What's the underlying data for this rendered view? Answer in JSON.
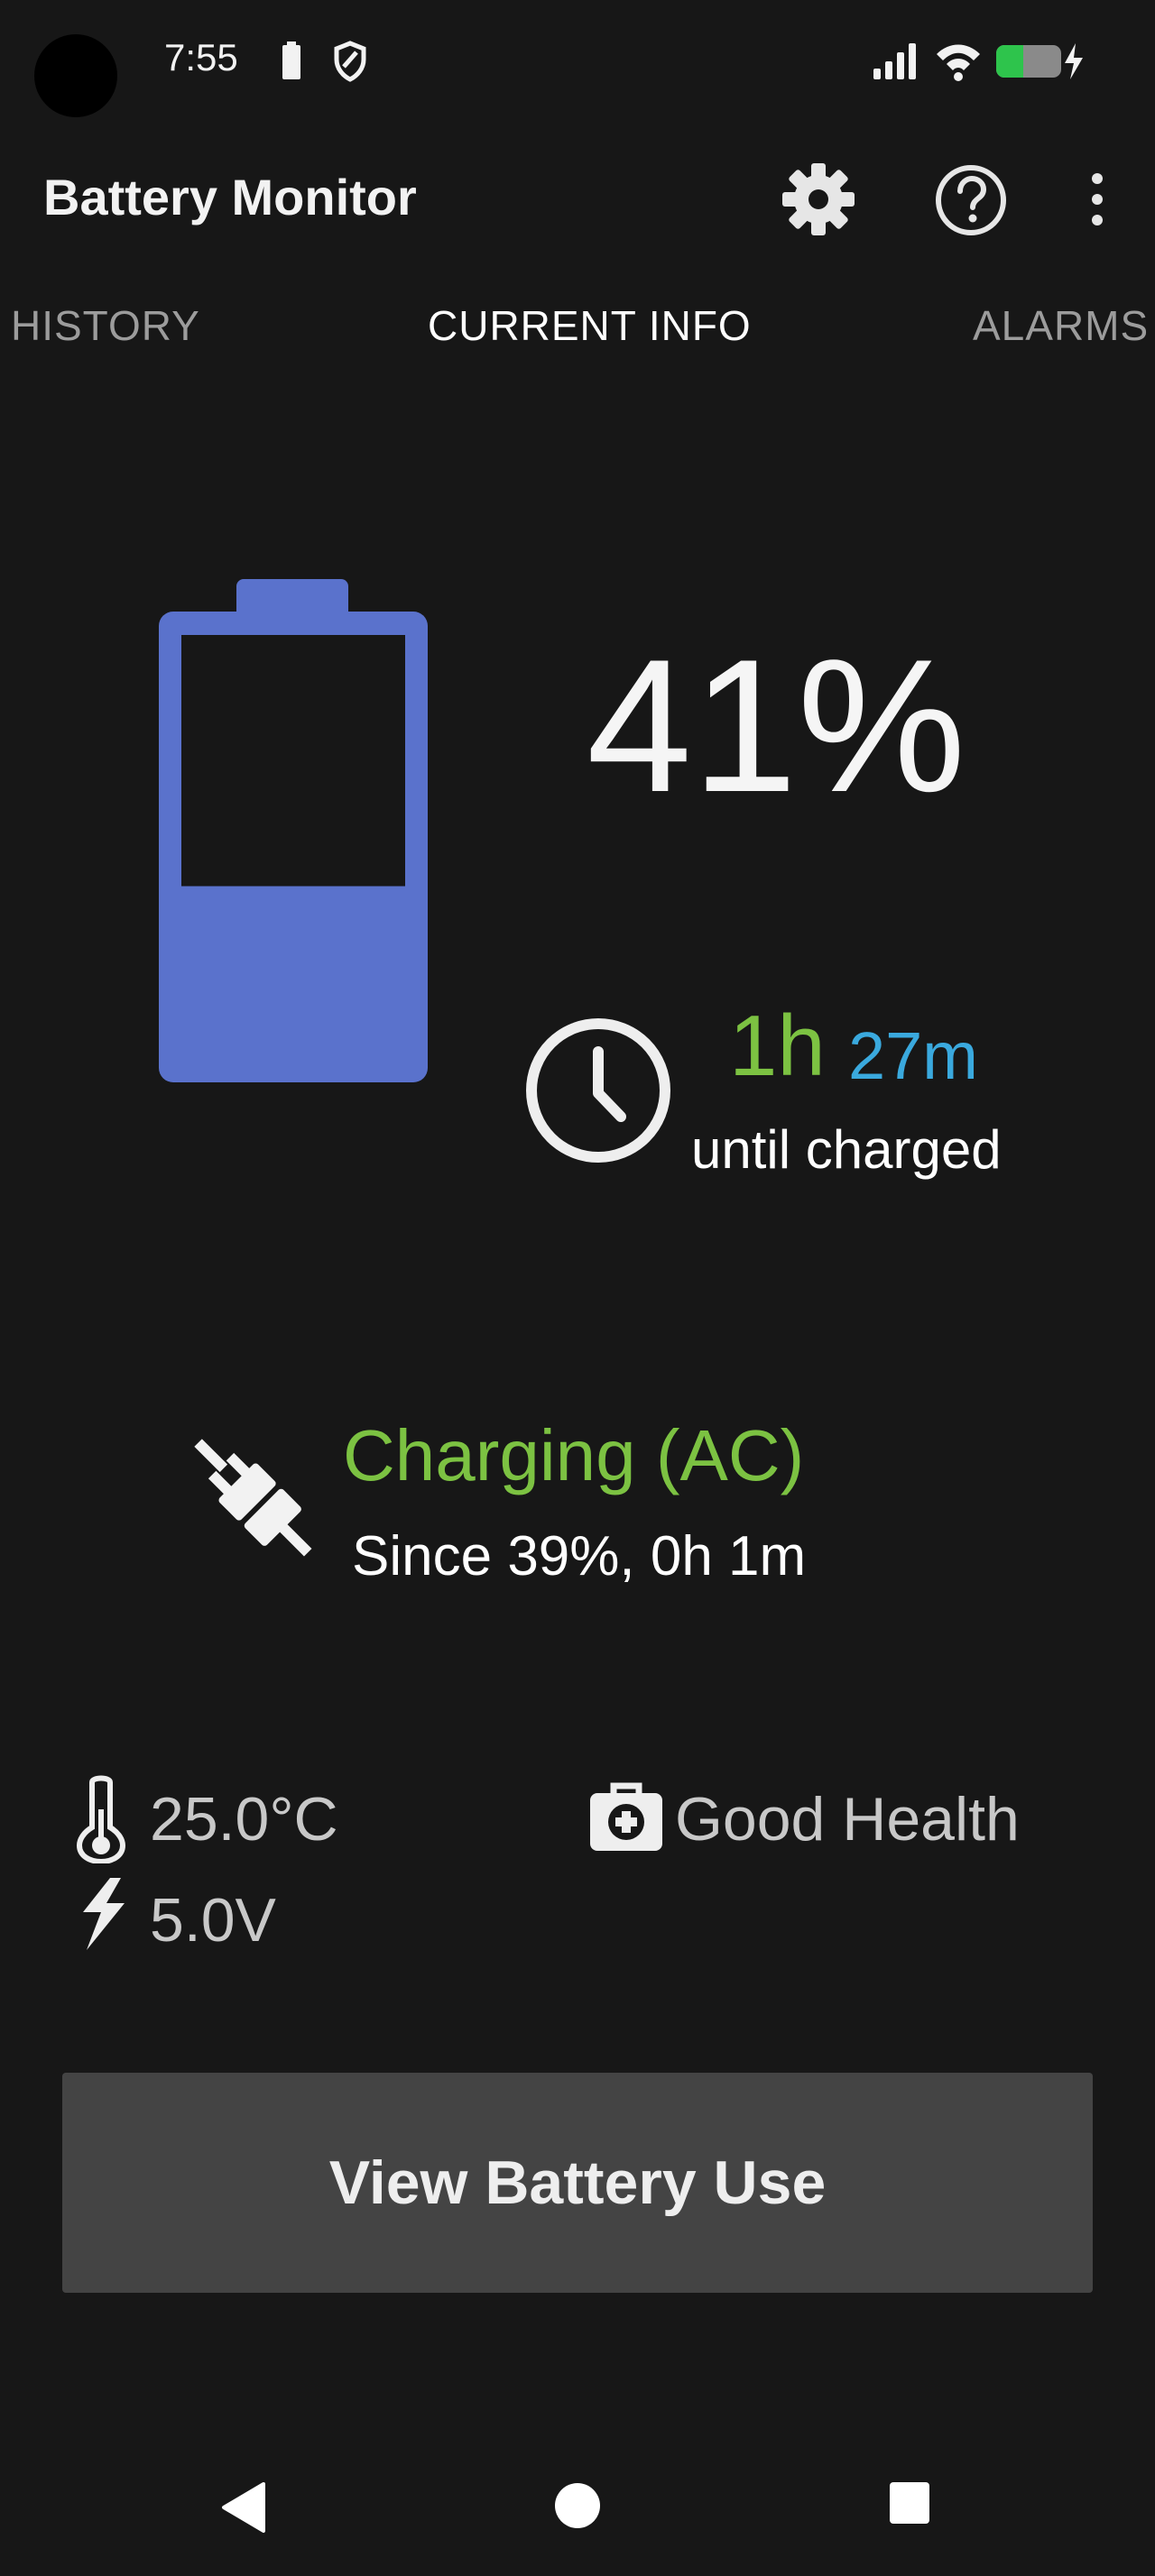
{
  "status_bar": {
    "time": "7:55",
    "icons": [
      "battery-saver-icon",
      "shield-icon",
      "signal-icon",
      "wifi-icon",
      "battery-charging-icon"
    ]
  },
  "app_bar": {
    "title": "Battery Monitor",
    "icons": [
      "gear-icon",
      "help-icon",
      "more-vert-icon"
    ]
  },
  "tabs": [
    {
      "label": "HISTORY",
      "active": false
    },
    {
      "label": "CURRENT INFO",
      "active": true
    },
    {
      "label": "ALARMS",
      "active": false
    }
  ],
  "battery": {
    "level_percent": 41,
    "percent_label": "41%",
    "color": "#5a72cc"
  },
  "time_remaining": {
    "hours": "1h",
    "minutes": "27m",
    "label": "until charged",
    "hours_color": "#7cc242",
    "minutes_color": "#3aa9de"
  },
  "charging": {
    "status": "Charging (AC)",
    "since": "Since 39%, 0h 1m",
    "color": "#7cc242"
  },
  "stats": {
    "temperature": "25.0°C",
    "voltage": "5.0V",
    "health": "Good Health"
  },
  "button": {
    "label": "View Battery Use"
  },
  "nav_bar": {
    "icons": [
      "back-icon",
      "home-icon",
      "recents-icon"
    ]
  }
}
